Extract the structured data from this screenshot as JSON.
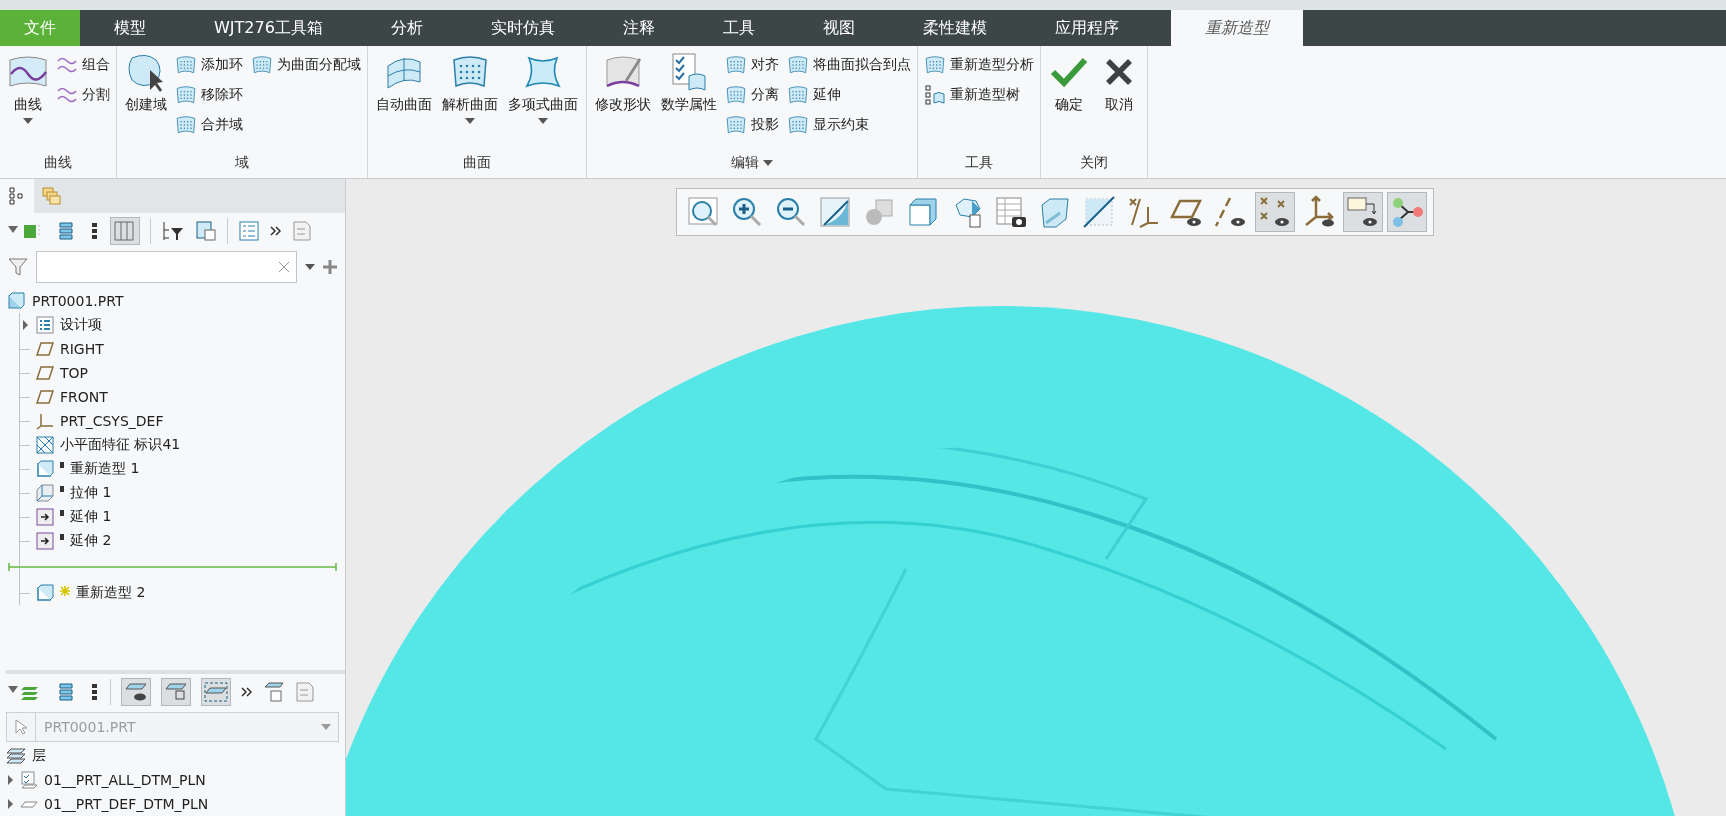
{
  "tabs": [
    {
      "label": "文件",
      "kind": "file",
      "selected": false
    },
    {
      "label": "模型",
      "kind": "tab",
      "selected": false
    },
    {
      "label": "WJT276工具箱",
      "kind": "tab",
      "selected": false
    },
    {
      "label": "分析",
      "kind": "tab",
      "selected": false
    },
    {
      "label": "实时仿真",
      "kind": "tab",
      "selected": false
    },
    {
      "label": "注释",
      "kind": "tab",
      "selected": false
    },
    {
      "label": "工具",
      "kind": "tab",
      "selected": false
    },
    {
      "label": "视图",
      "kind": "tab",
      "selected": false
    },
    {
      "label": "柔性建模",
      "kind": "tab",
      "selected": false
    },
    {
      "label": "应用程序",
      "kind": "tab",
      "selected": false
    },
    {
      "label": "重新造型",
      "kind": "tab",
      "selected": true
    }
  ],
  "ribbon": [
    {
      "title": "曲线",
      "items": [
        {
          "label": "曲线",
          "kind": "large",
          "dropdown": true
        },
        {
          "label": "组合",
          "kind": "small"
        },
        {
          "label": "分割",
          "kind": "small"
        }
      ]
    },
    {
      "title": "域",
      "items": [
        {
          "label": "创建域",
          "kind": "large"
        },
        {
          "label": "添加环",
          "kind": "small"
        },
        {
          "label": "移除环",
          "kind": "small"
        },
        {
          "label": "合并域",
          "kind": "small"
        },
        {
          "label": "为曲面分配域",
          "kind": "small"
        }
      ]
    },
    {
      "title": "曲面",
      "items": [
        {
          "label": "自动曲面",
          "kind": "large"
        },
        {
          "label": "解析曲面",
          "kind": "large",
          "dropdown": true
        },
        {
          "label": "多项式曲面",
          "kind": "large",
          "dropdown": true
        }
      ]
    },
    {
      "title": "编辑",
      "dropdown": true,
      "items": [
        {
          "label": "修改形状",
          "kind": "large"
        },
        {
          "label": "数学属性",
          "kind": "large"
        },
        {
          "label": "对齐",
          "kind": "small"
        },
        {
          "label": "分离",
          "kind": "small"
        },
        {
          "label": "投影",
          "kind": "small"
        },
        {
          "label": "将曲面拟合到点",
          "kind": "small"
        },
        {
          "label": "延伸",
          "kind": "small"
        },
        {
          "label": "显示约束",
          "kind": "small"
        }
      ]
    },
    {
      "title": "工具",
      "items": [
        {
          "label": "重新造型分析",
          "kind": "small"
        },
        {
          "label": "重新造型树",
          "kind": "small"
        }
      ]
    },
    {
      "title": "关闭",
      "items": [
        {
          "label": "确定",
          "kind": "large"
        },
        {
          "label": "取消",
          "kind": "large"
        }
      ]
    }
  ],
  "panel_tabs": [
    {
      "selected": true
    },
    {
      "selected": false
    }
  ],
  "model_tree": {
    "root": {
      "label": "PRT0001.PRT",
      "children": [
        {
          "label": "设计项",
          "kind": "design-items",
          "expanded": false
        },
        {
          "label": "RIGHT",
          "kind": "plane"
        },
        {
          "label": "TOP",
          "kind": "plane"
        },
        {
          "label": "FRONT",
          "kind": "plane"
        },
        {
          "label": "PRT_CSYS_DEF",
          "kind": "csys"
        },
        {
          "label": "小平面特征 标识41",
          "kind": "facet"
        },
        {
          "label": "重新造型 1",
          "kind": "restyle",
          "new": false
        },
        {
          "label": "拉伸 1",
          "kind": "extrude",
          "new": false
        },
        {
          "label": "延伸 1",
          "kind": "extend",
          "new": false
        },
        {
          "label": "延伸 2",
          "kind": "extend",
          "new": false
        },
        {
          "kind": "insert-marker"
        },
        {
          "label": "重新造型 2",
          "kind": "restyle",
          "new": true
        }
      ]
    }
  },
  "layers": {
    "selector": {
      "value": "PRT0001.PRT",
      "disabled": true
    },
    "header": "层",
    "items": [
      {
        "label": "01__PRT_ALL_DTM_PLN",
        "kind": "rule-layer",
        "expanded": false
      },
      {
        "label": "01__PRT_DEF_DTM_PLN",
        "kind": "layer",
        "expanded": false
      }
    ]
  },
  "view_toolbar": [
    {
      "selected": false
    },
    {
      "selected": false
    },
    {
      "selected": false
    },
    {
      "selected": false
    },
    {
      "selected": false
    },
    {
      "selected": false
    },
    {
      "selected": false
    },
    {
      "selected": false
    },
    {
      "selected": false
    },
    {
      "selected": false
    },
    {
      "selected": false
    },
    {
      "selected": false
    },
    {
      "selected": false
    },
    {
      "selected": true
    },
    {
      "selected": false
    },
    {
      "selected": true
    },
    {
      "selected": true
    }
  ]
}
